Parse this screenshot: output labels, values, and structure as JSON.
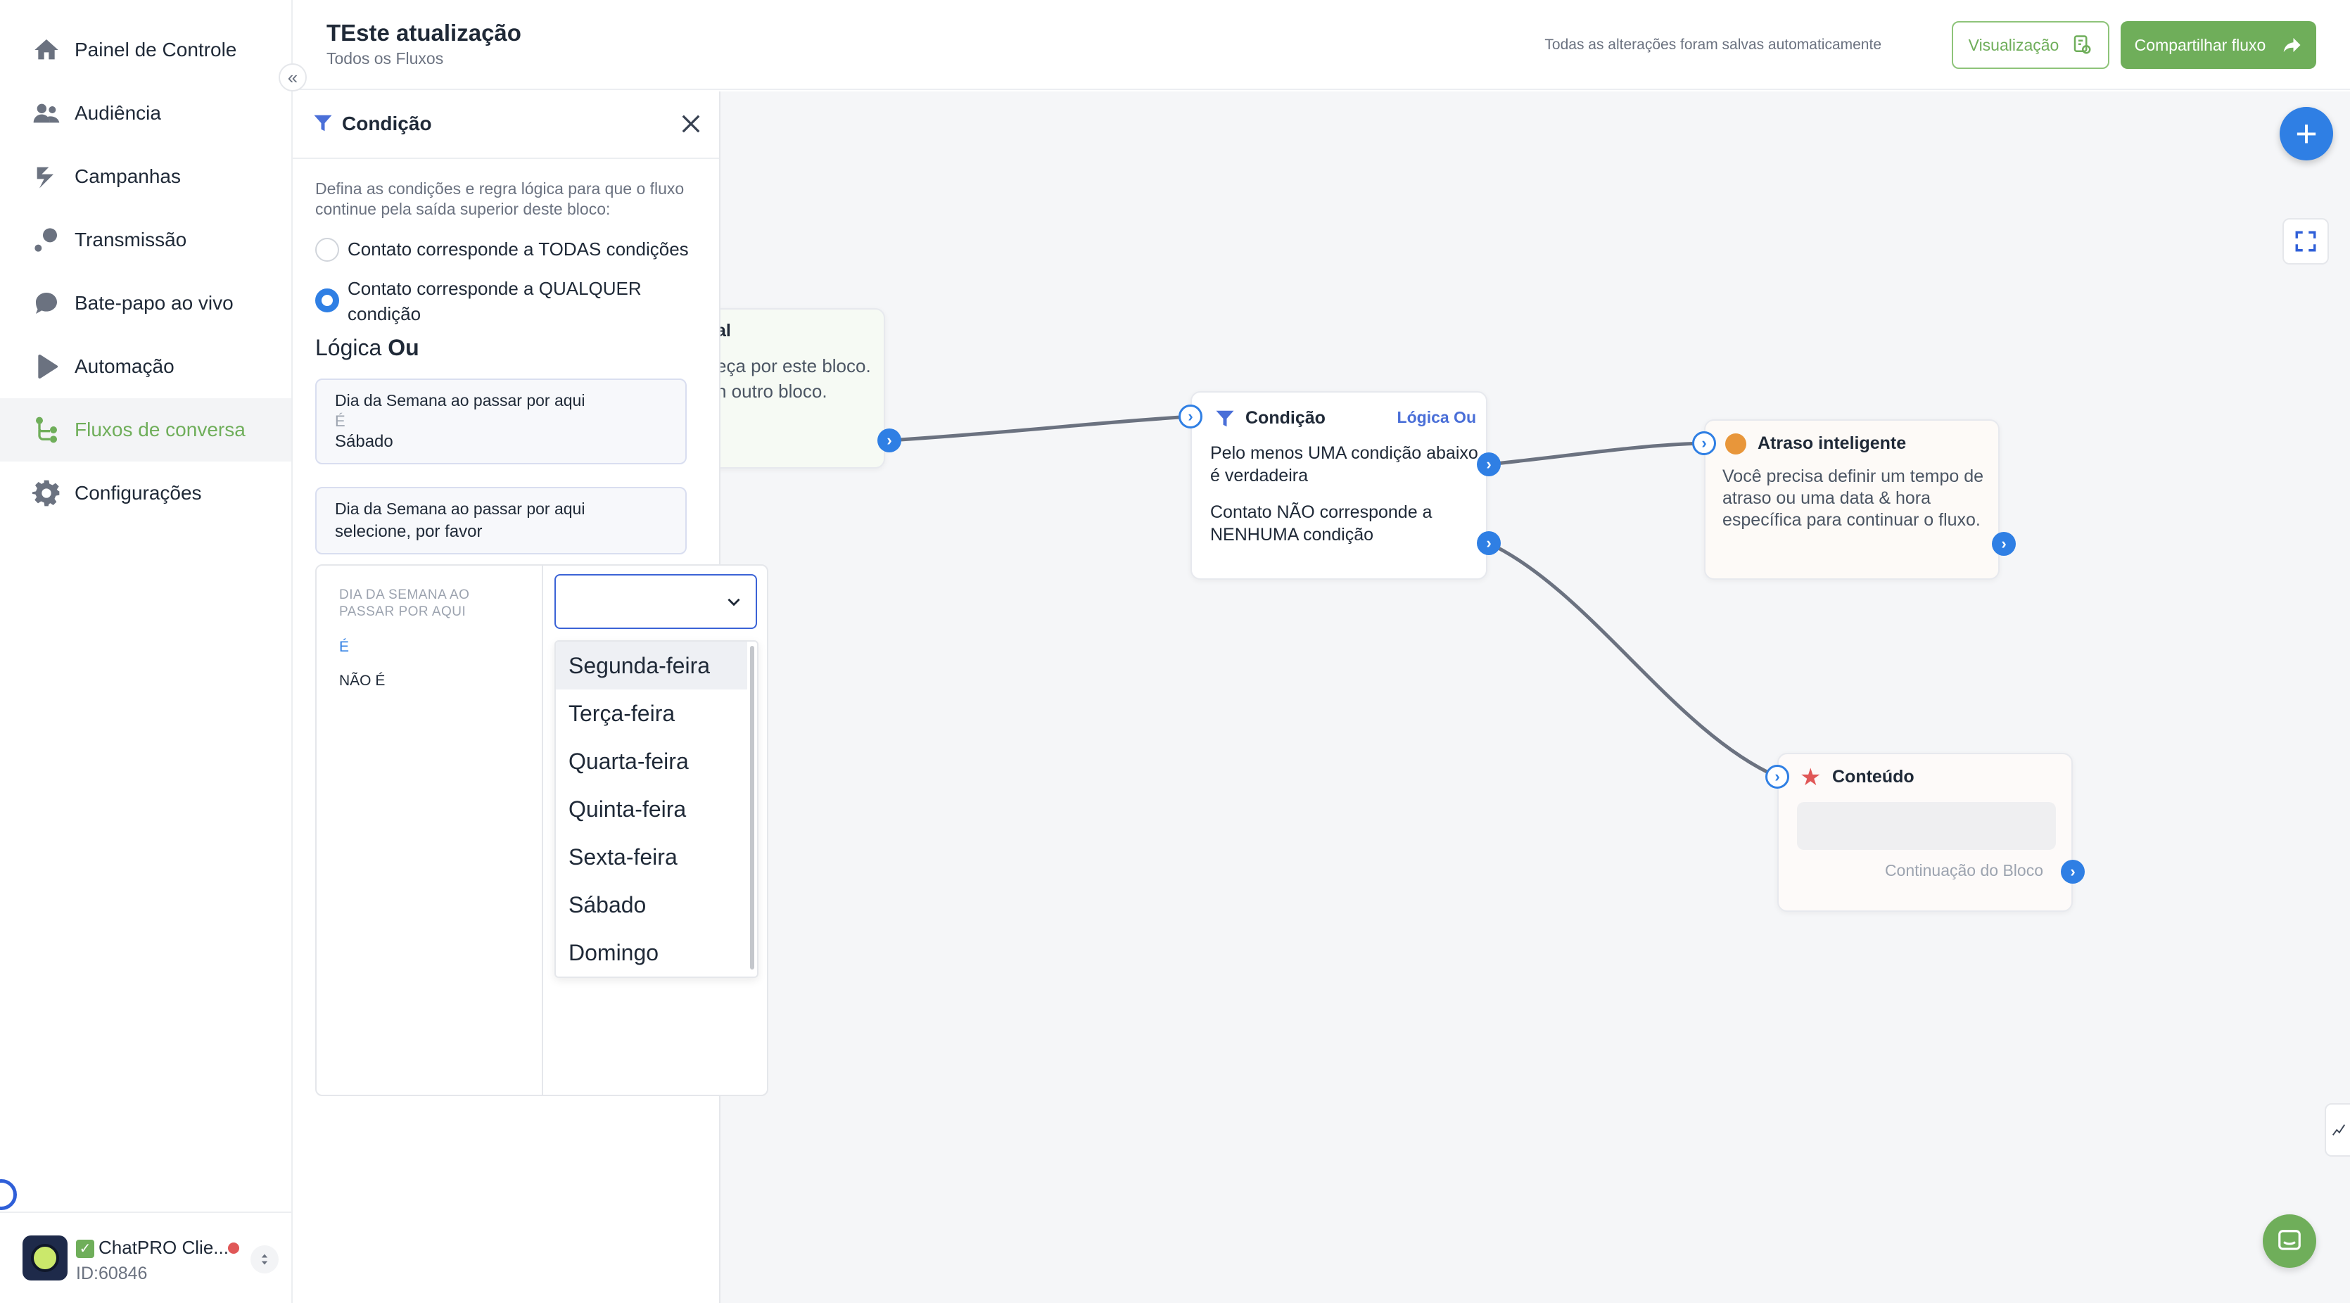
{
  "sidebar": {
    "items": [
      {
        "label": "Painel de Controle",
        "icon": "home-icon"
      },
      {
        "label": "Audiência",
        "icon": "users-icon"
      },
      {
        "label": "Campanhas",
        "icon": "campaign-icon"
      },
      {
        "label": "Transmissão",
        "icon": "broadcast-icon"
      },
      {
        "label": "Bate-papo ao vivo",
        "icon": "chat-bubble-icon"
      },
      {
        "label": "Automação",
        "icon": "play-icon"
      },
      {
        "label": "Fluxos de conversa",
        "icon": "flow-icon",
        "active": true
      },
      {
        "label": "Configurações",
        "icon": "gear-icon"
      }
    ],
    "collapse_glyph": "«",
    "account": {
      "name": "ChatPRO Clie...",
      "verified_glyph": "✓",
      "id": "ID:60846",
      "status_color": "#e05757"
    }
  },
  "header": {
    "title": "TEste atualização",
    "breadcrumb": "Todos os Fluxos",
    "autosave": "Todas as alterações foram salvas automaticamente",
    "preview_label": "Visualização",
    "share_label": "Compartilhar fluxo"
  },
  "colors": {
    "accent_green": "#6fae5a",
    "accent_blue": "#2f7fe4",
    "edge": "#6b7280"
  },
  "panel": {
    "title": "Condição",
    "description": "Defina as condições e regra lógica para que o fluxo continue pela saída superior deste bloco:",
    "radio_all": "Contato corresponde a TODAS condições",
    "radio_any": "Contato corresponde a QUALQUER condição",
    "logic_prefix": "Lógica",
    "logic_value": "Ou",
    "conditions": [
      {
        "field": "Dia da Semana ao passar por aqui",
        "operator": "É",
        "value": "Sábado"
      },
      {
        "field": "Dia da Semana ao passar por aqui",
        "value": "selecione, por favor"
      }
    ],
    "editor": {
      "field_label": "DIA DA SEMANA AO PASSAR POR AQUI",
      "op_is": "É",
      "op_not": "NÃO É",
      "options": [
        "Segunda-feira",
        "Terça-feira",
        "Quarta-feira",
        "Quinta-feira",
        "Sexta-feira",
        "Sábado",
        "Domingo"
      ]
    }
  },
  "canvas": {
    "start_node": {
      "title": "al",
      "text": "eça por este bloco. n outro bloco."
    },
    "condition_node": {
      "title": "Condição",
      "logic_tag": "Lógica Ou",
      "line1": "Pelo menos UMA condição abaixo é verdadeira",
      "line2": "Contato NÃO corresponde a NENHUMA condição"
    },
    "delay_node": {
      "title": "Atraso inteligente",
      "text": "Você precisa definir um tempo de atraso ou uma data & hora específica para continuar o fluxo."
    },
    "content_node": {
      "title": "Conteúdo",
      "continuation": "Continuação do Bloco"
    },
    "add_glyph": "+",
    "port_glyph": "›"
  }
}
